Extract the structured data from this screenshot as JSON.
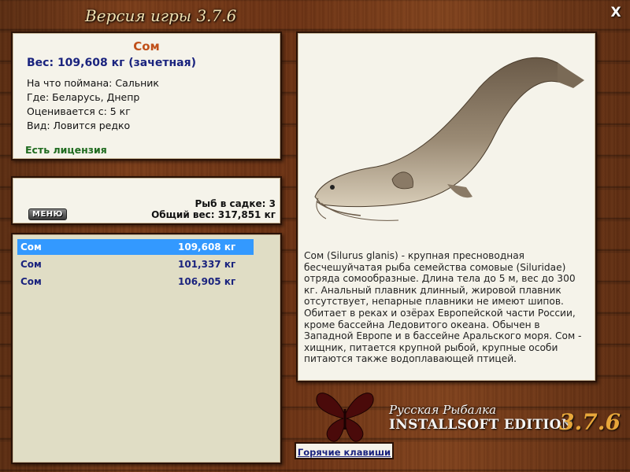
{
  "window": {
    "title": "Версия игры 3.7.6",
    "close_label": "X"
  },
  "info": {
    "fish_name": "Сом",
    "weight": "Вес: 109,608 кг (зачетная)",
    "caught_on": "На что поймана: Сальник",
    "where": "Где: Беларусь, Днепр",
    "rated_from": "Оценивается с: 5 кг",
    "kind": "Вид: Ловится редко",
    "license": "Есть лицензия"
  },
  "stats": {
    "fish_count": "Рыб в садке: 3",
    "total_weight": "Общий вес: 317,851 кг",
    "menu_label": "МЕНЮ"
  },
  "catch_list": [
    {
      "name": "Сом",
      "weight": "109,608 кг"
    },
    {
      "name": "Сом",
      "weight": "101,337 кг"
    },
    {
      "name": "Сом",
      "weight": "106,905 кг"
    }
  ],
  "description": "Сом (Silurus glanis) - крупная пресноводная бесчешуйчатая рыба семейства сомовые (Siluridae) отряда сомообразные. Длина тела до 5 м, вес до 300 кг. Анальный плавник длинный, жировой плавник отсутствует, непарные плавники не имеют шипов. Обитает в реках и озёрах Европейской части России, кроме бассейна Ледовитого океана. Обычен в Западной Европе и в бассейне Аральского моря. Сом - хищник, питается крупной рыбой, крупные особи питаются также водоплавающей птицей.",
  "brand": {
    "line1": "Русская Рыбалка",
    "line2": "INSTALLSOFT EDITION",
    "version": "3.7.6"
  },
  "hotkeys_label": "Горячие клавиши",
  "colors": {
    "selected_row": "#3399ff",
    "fish_name": "#c0501a",
    "weight": "#1a237e",
    "license": "#1f6b1f"
  }
}
